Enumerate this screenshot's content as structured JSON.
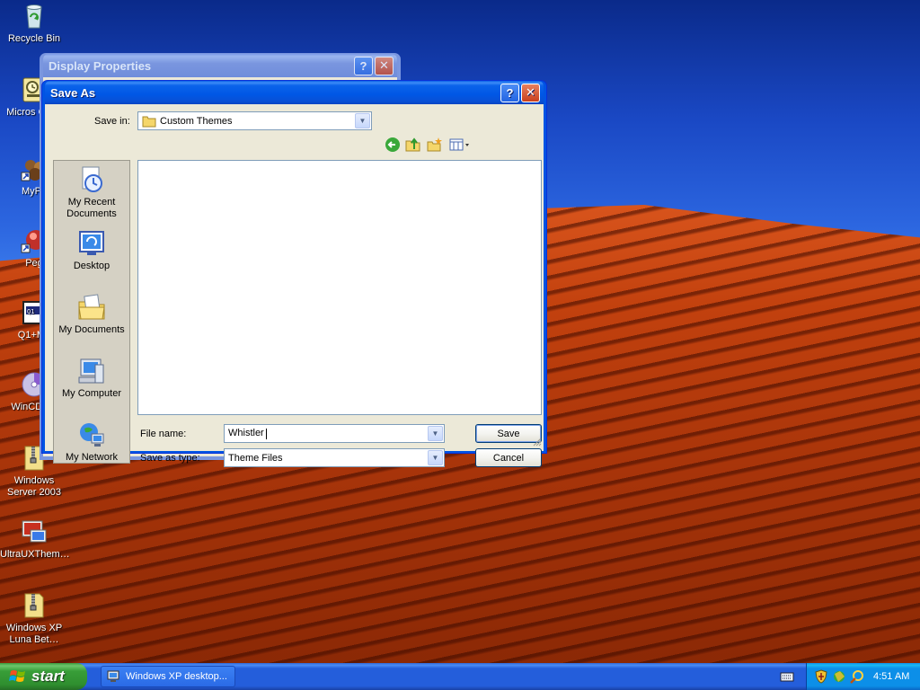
{
  "desktop": {
    "icons": [
      {
        "label": "Recycle Bin",
        "icon": "recycle-bin-icon"
      },
      {
        "label": "Micros Outlo",
        "icon": "outlook-icon"
      },
      {
        "label": "MyPa",
        "icon": "mypal-icon"
      },
      {
        "label": "Peg",
        "icon": "peg-icon"
      },
      {
        "label": "Q1+M3",
        "icon": "q1m3-icon"
      },
      {
        "label": "WinCDEm",
        "icon": "wincdemu-icon"
      },
      {
        "label": "Windows Server 2003",
        "icon": "zip-folder-icon"
      },
      {
        "label": "UltraUXThem…",
        "icon": "ultrauxtheme-icon"
      },
      {
        "label": "Windows XP Luna Bet…",
        "icon": "zip-folder-icon"
      }
    ]
  },
  "display_properties": {
    "title": "Display Properties",
    "help_label": "?",
    "close_label": "✕"
  },
  "save_as": {
    "title": "Save As",
    "help_label": "?",
    "close_label": "✕",
    "save_in_label": "Save in:",
    "save_in_value": "Custom Themes",
    "places": [
      {
        "label": "My Recent Documents",
        "icon": "recent-documents-icon"
      },
      {
        "label": "Desktop",
        "icon": "desktop-icon"
      },
      {
        "label": "My Documents",
        "icon": "my-documents-icon"
      },
      {
        "label": "My Computer",
        "icon": "my-computer-icon"
      },
      {
        "label": "My Network",
        "icon": "my-network-icon"
      }
    ],
    "file_name_label": "File name:",
    "file_name_value": "Whistler",
    "save_as_type_label": "Save as type:",
    "save_as_type_value": "Theme Files",
    "save_button": "Save",
    "cancel_button": "Cancel"
  },
  "taskbar": {
    "start_label": "start",
    "task_button_label": "Windows XP desktop...",
    "clock": "4:51 AM"
  }
}
